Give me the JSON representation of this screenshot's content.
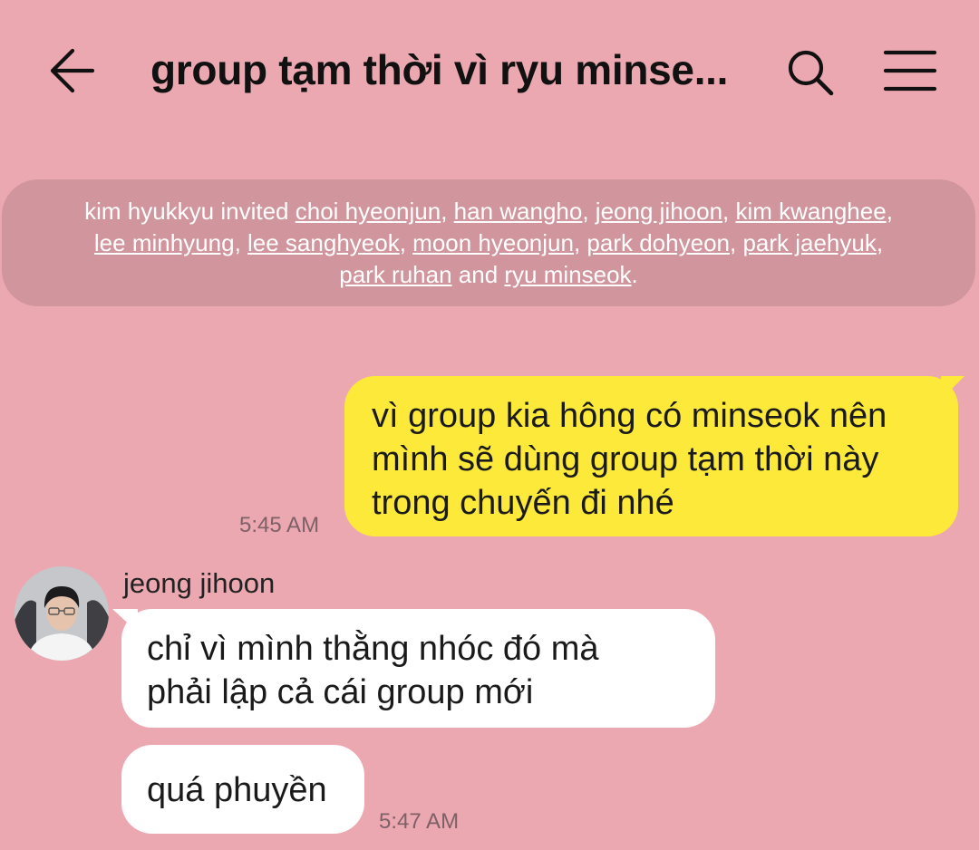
{
  "header": {
    "title": "group tạm thời vì ryu minse..."
  },
  "notice": {
    "inviter": "kim hyukkyu",
    "invited_text": " invited ",
    "invitees": [
      "choi hyeonjun",
      "han wangho",
      "jeong jihoon",
      "kim kwanghee",
      "lee minhyung",
      "lee sanghyeok",
      "moon hyeonjun",
      "park dohyeon",
      "park jaehyuk",
      "park ruhan",
      "ryu minseok"
    ],
    "separator": ", ",
    "and_text": " and ",
    "end_text": "."
  },
  "messages": {
    "outgoing": {
      "lines": [
        "vì group kia hông có minseok nên",
        "mình sẽ dùng group tạm thời này",
        "trong chuyến đi nhé"
      ],
      "time": "5:45 AM"
    },
    "incoming": {
      "sender": "jeong jihoon",
      "bubble1_lines": [
        "chỉ vì mình thằng nhóc đó mà",
        "phải lập cả cái group mới"
      ],
      "bubble2_text": "quá phuyền",
      "time": "5:47 AM"
    }
  },
  "icons": {
    "back": "back-arrow-icon",
    "search": "search-icon",
    "menu": "menu-icon"
  },
  "colors": {
    "background": "#eca8b1",
    "notice_bg": "#d0959d",
    "outgoing_bubble": "#fde93a",
    "incoming_bubble": "#ffffff"
  }
}
